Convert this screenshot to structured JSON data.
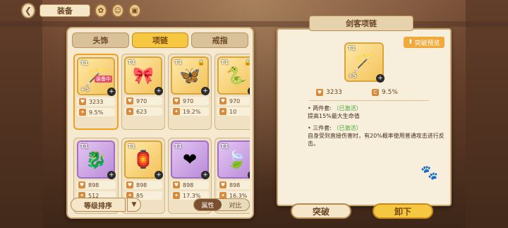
{
  "header": {
    "title": "装备"
  },
  "tabs": [
    {
      "label": "头饰",
      "active": false
    },
    {
      "label": "项链",
      "active": true
    },
    {
      "label": "戒指",
      "active": false
    }
  ],
  "items": [
    {
      "tier": "T1",
      "level": "+5",
      "frame": "gold",
      "locked": false,
      "badge": "装备中",
      "glyph": "🪄",
      "stat1": "3233",
      "stat2": "9.5%",
      "selected": true
    },
    {
      "tier": "T1",
      "level": "",
      "frame": "gold",
      "locked": false,
      "badge": "",
      "glyph": "🎀",
      "stat1": "970",
      "stat2": "623",
      "selected": false
    },
    {
      "tier": "T1",
      "level": "",
      "frame": "gold",
      "locked": true,
      "badge": "",
      "glyph": "🦋",
      "stat1": "970",
      "stat2": "19.2%",
      "selected": false
    },
    {
      "tier": "T1",
      "level": "",
      "frame": "gold",
      "locked": true,
      "badge": "",
      "glyph": "🐍",
      "stat1": "970",
      "stat2": "10",
      "selected": false
    },
    {
      "tier": "T1",
      "level": "",
      "frame": "purple",
      "locked": false,
      "badge": "",
      "glyph": "🐉",
      "stat1": "898",
      "stat2": "512",
      "selected": false
    },
    {
      "tier": "T1",
      "level": "",
      "frame": "gold",
      "locked": false,
      "badge": "",
      "glyph": "🏮",
      "stat1": "898",
      "stat2": "85",
      "selected": false
    },
    {
      "tier": "T1",
      "level": "",
      "frame": "purple",
      "locked": false,
      "badge": "",
      "glyph": "❤",
      "stat1": "898",
      "stat2": "17.3%",
      "selected": false
    },
    {
      "tier": "T1",
      "level": "",
      "frame": "purple",
      "locked": false,
      "badge": "",
      "glyph": "🍃",
      "stat1": "898",
      "stat2": "16.3%",
      "selected": false
    }
  ],
  "bottom": {
    "sort_label": "等级排序",
    "toggle_on": "属性",
    "toggle_off": "对比"
  },
  "detail": {
    "set_name": "剑客项链",
    "preview_label": "突破预览",
    "hp": "3233",
    "crit": "9.5%",
    "two_piece_label": "两件套:",
    "two_piece_status": "（已激活）",
    "two_piece_text": "提高15%最大生命值",
    "three_piece_label": "三件套:",
    "three_piece_status": "（已激活）",
    "three_piece_text": "自身受到直接伤害时，有20%概率使用普通攻击进行反击。"
  },
  "actions": {
    "breakthrough": "突破",
    "unequip": "卸下"
  }
}
